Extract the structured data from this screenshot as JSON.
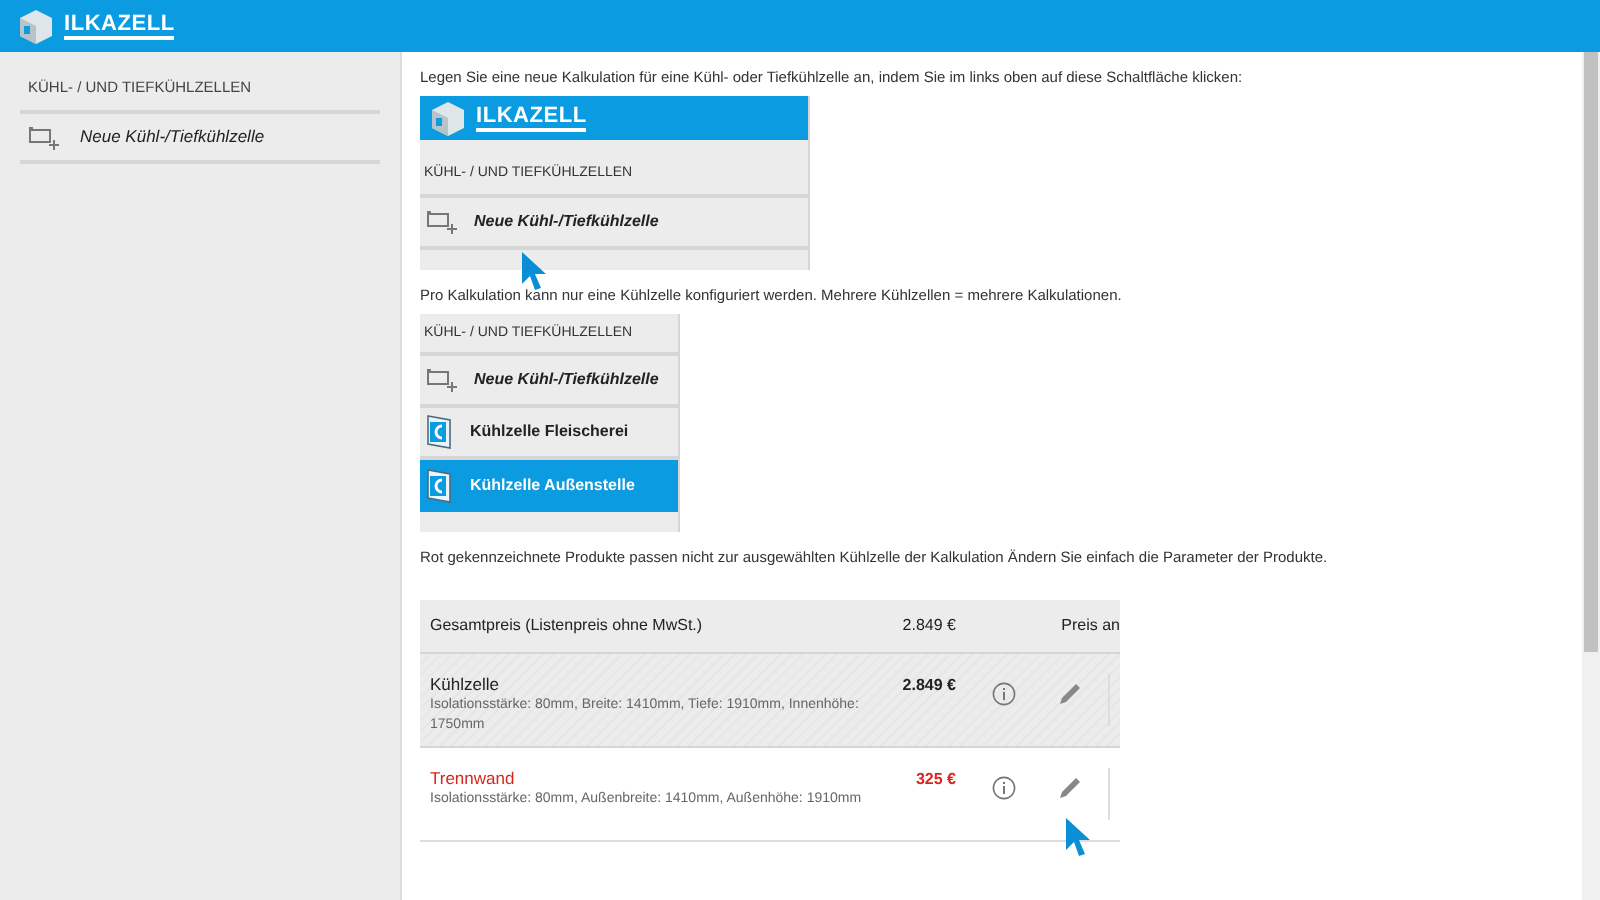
{
  "header": {
    "logo": "ILKAZELL"
  },
  "sidebar": {
    "heading": "KÜHL- / UND TIEFKÜHLZELLEN",
    "items": [
      {
        "label": "Neue Kühl-/Tiefkühlzelle",
        "kind": "new"
      }
    ]
  },
  "content": [
    {
      "kind": "text",
      "text": "Legen Sie eine neue Kalkulation für eine Kühl- oder Tiefkühlzelle an, indem Sie im links oben auf diese Schaltfläche klicken:"
    },
    {
      "kind": "menu",
      "logo": "ILKAZELL",
      "heading": "KÜHL- / UND TIEFKÜHLZELLEN",
      "items": [
        {
          "label": "Neue Kühl-/Tiefkühlzelle",
          "kind": "new",
          "selected": false,
          "pointer": true
        }
      ]
    },
    {
      "kind": "text",
      "text": "Pro Kalkulation kann nur eine Kühlzelle konfiguriert werden. Mehrere Kühlzellen = mehrere Kalkulationen."
    },
    {
      "kind": "menu",
      "heading": "KÜHL- / UND TIEFKÜHLZELLEN",
      "items": [
        {
          "label": "Neue Kühl-/Tiefkühlzelle",
          "kind": "new",
          "selected": false,
          "pointer": false
        },
        {
          "label": "Kühlzelle Fleischerei",
          "kind": "cell",
          "selected": false,
          "pointer": false
        },
        {
          "label": "Kühlzelle Außenstelle",
          "kind": "cell",
          "selected": true,
          "pointer": false
        }
      ]
    },
    {
      "kind": "text",
      "text": "Rot gekennzeichnete Produkte passen nicht zur ausgewählten Kühlzelle der Kalkulation Ändern Sie einfach die Parameter der Produkte."
    },
    {
      "kind": "table",
      "header": {
        "label": "Gesamtpreis (Listenpreis ohne MwSt.)",
        "price": "2.849 €",
        "column_3": "Preis an"
      },
      "rows": [
        {
          "name": "Kühlzelle",
          "details": "Isolationsstärke: 80mm, Breite: 1410mm, Tiefe: 1910mm, Innenhöhe: 1750mm",
          "price": "2.849 €",
          "invalid": false,
          "pointer": false
        },
        {
          "name": "Trennwand",
          "details": "Isolationsstärke: 80mm, Außenbreite: 1410mm, Außenhöhe: 1910mm",
          "price": "325 €",
          "invalid": true,
          "pointer": true
        }
      ]
    }
  ]
}
